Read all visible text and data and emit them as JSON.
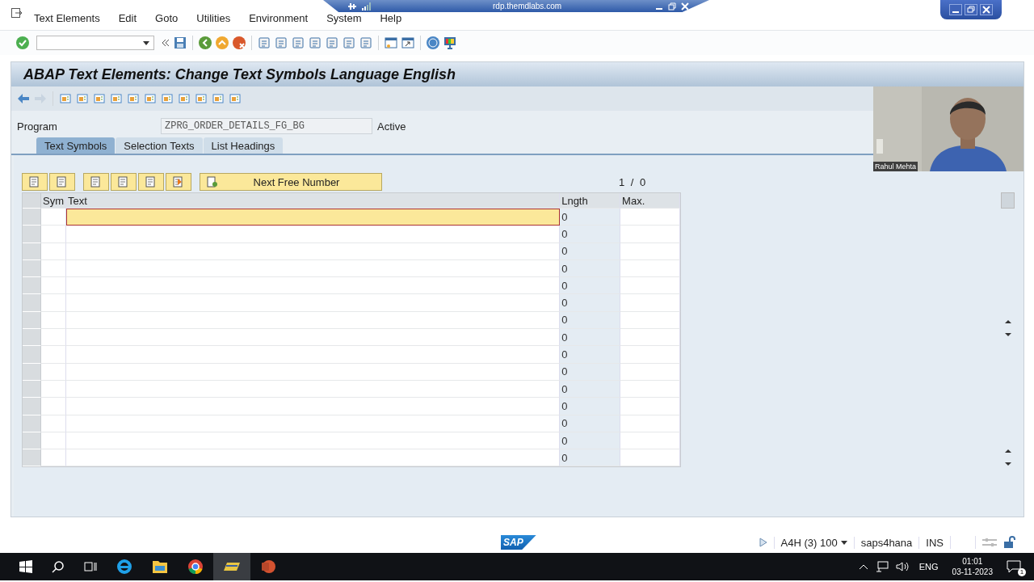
{
  "rdp": {
    "host": "rdp.themdlabs.com"
  },
  "menu": [
    "Text Elements",
    "Edit",
    "Goto",
    "Utilities",
    "Environment",
    "System",
    "Help"
  ],
  "title": "ABAP Text Elements: Change Text Symbols Language English",
  "program": {
    "label": "Program",
    "value": "ZPRG_ORDER_DETAILS_FG_BG",
    "status": "Active"
  },
  "tabs": [
    {
      "label": "Text Symbols",
      "selected": true
    },
    {
      "label": "Selection Texts",
      "selected": false
    },
    {
      "label": "List Headings",
      "selected": false
    }
  ],
  "table_toolbar": {
    "button": "Next Free Number",
    "counter": "1 / 0"
  },
  "table": {
    "columns": [
      "Sym",
      "Text",
      "Lngth",
      "Max."
    ],
    "rows": [
      {
        "length": "0",
        "selected": true
      },
      {
        "length": "0",
        "selected": false
      },
      {
        "length": "0",
        "selected": false
      },
      {
        "length": "0",
        "selected": false
      },
      {
        "length": "0",
        "selected": false
      },
      {
        "length": "0",
        "selected": false
      },
      {
        "length": "0",
        "selected": false
      },
      {
        "length": "0",
        "selected": false
      },
      {
        "length": "0",
        "selected": false
      },
      {
        "length": "0",
        "selected": false
      },
      {
        "length": "0",
        "selected": false
      },
      {
        "length": "0",
        "selected": false
      },
      {
        "length": "0",
        "selected": false
      },
      {
        "length": "0",
        "selected": false
      },
      {
        "length": "0",
        "selected": false
      }
    ]
  },
  "video": {
    "kind": "picture",
    "caption": "Rahul Mehta"
  },
  "status_bar": {
    "logo": "SAP",
    "system": "A4H (3) 100",
    "server": "saps4hana",
    "mode": "INS"
  },
  "taskbar": {
    "language": "ENG",
    "time": "01:01",
    "date": "03-11-2023",
    "notifications": "1"
  }
}
